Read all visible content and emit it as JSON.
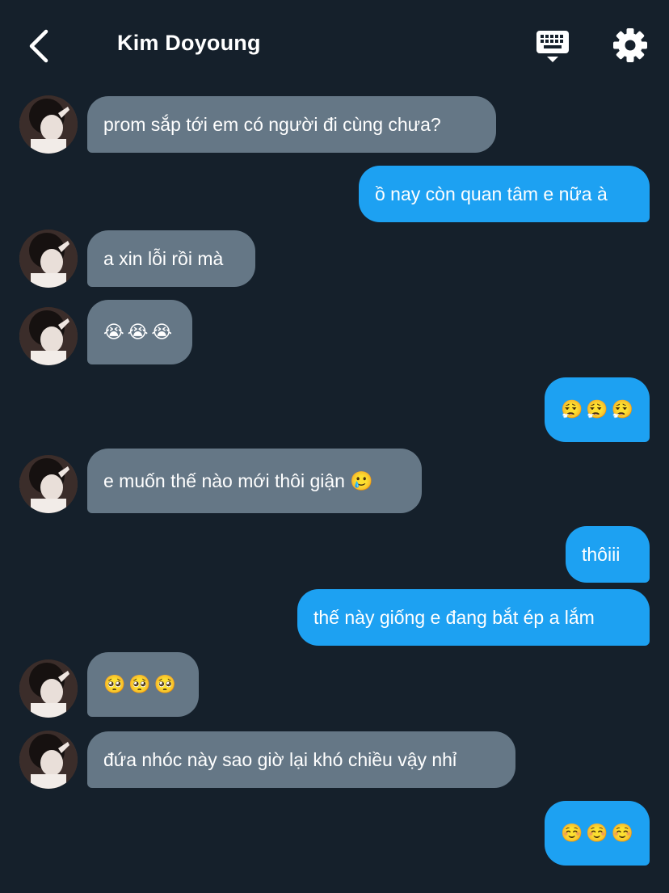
{
  "header": {
    "title": "Kim Doyoung",
    "back_icon": "chevron-left-icon",
    "keyboard_icon": "keyboard-icon",
    "settings_icon": "gear-icon"
  },
  "colors": {
    "background": "#15202b",
    "incoming_bubble": "#657786",
    "outgoing_bubble": "#1da1f2"
  },
  "messages": [
    {
      "side": "in",
      "text": "prom sắp tới em có người đi cùng chưa?"
    },
    {
      "side": "out",
      "text": "ồ nay còn quan tâm e nữa à"
    },
    {
      "side": "in",
      "text": "a xin lỗi rồi mà"
    },
    {
      "side": "in",
      "text": "😭😭😭"
    },
    {
      "side": "out",
      "text": "😮‍💨😮‍💨😮‍💨"
    },
    {
      "side": "in",
      "text": "e muốn thế nào mới thôi giận 🥲"
    },
    {
      "side": "out",
      "text": "thôiii"
    },
    {
      "side": "out",
      "text": "thế này giống e đang bắt ép a lắm"
    },
    {
      "side": "in",
      "text": "🥺🥺🥺"
    },
    {
      "side": "in",
      "text": "đứa nhóc này sao giờ lại khó chiều vậy nhỉ"
    },
    {
      "side": "out",
      "text": "☺️☺️☺️"
    }
  ]
}
